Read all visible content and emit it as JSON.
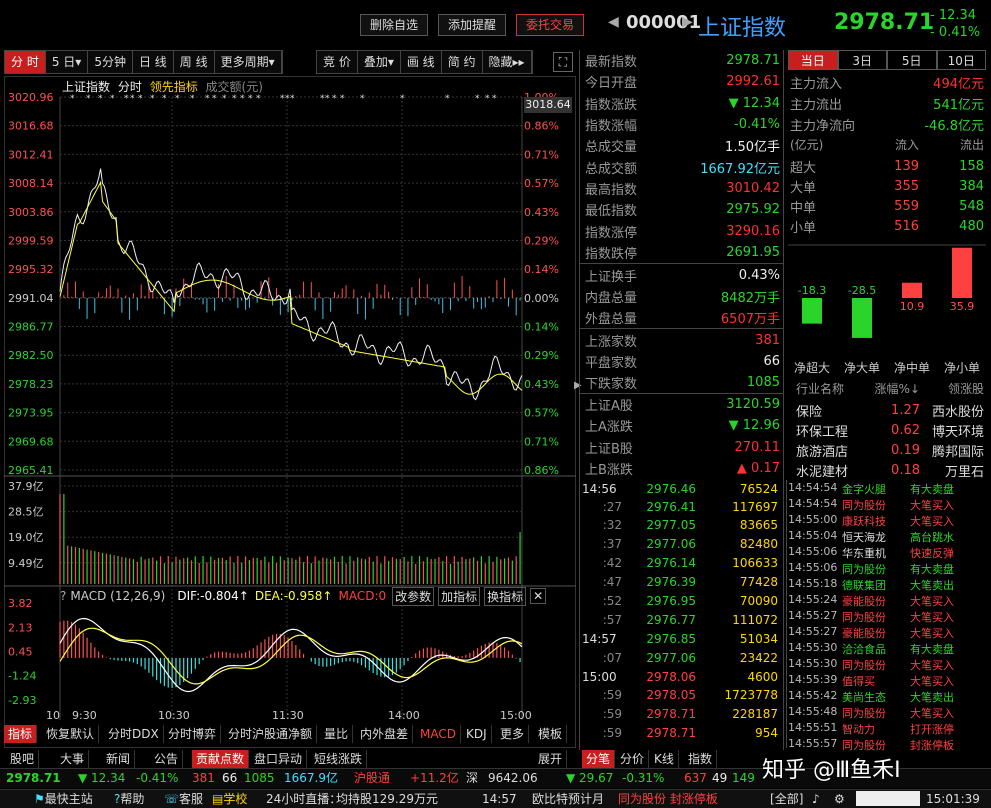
{
  "header": {
    "btn_delete": "删除自选",
    "btn_alert": "添加提醒",
    "btn_order": "委托交易",
    "code": "000001",
    "name": "上证指数",
    "price": "2978.71",
    "change": "- 12.34",
    "pct": "- 0.41%"
  },
  "toolbar": [
    "分 时",
    "5 日▾",
    "5分钟",
    "日 线",
    "周 线",
    "更多周期▾",
    "竞 价",
    "叠加▾",
    "画 线",
    "简 约",
    "隐藏▸▸"
  ],
  "chart_header": {
    "a": "上证指数",
    "b": "分时",
    "c": "领先指标",
    "d": "成交额(元)"
  },
  "price_axis_left": [
    "3020.96",
    "3016.68",
    "3012.41",
    "3008.14",
    "3003.86",
    "2999.59",
    "2995.32",
    "2991.04",
    "2986.77",
    "2982.50",
    "2978.23",
    "2973.95",
    "2969.68",
    "2965.41"
  ],
  "price_axis_right": [
    "1.00%",
    "0.86%",
    "0.71%",
    "0.57%",
    "0.43%",
    "0.29%",
    "0.14%",
    "0.00%",
    "0.14%",
    "0.29%",
    "0.43%",
    "0.57%",
    "0.71%",
    "0.86%"
  ],
  "hover_label": "3018.64",
  "vol_axis": [
    "37.9亿",
    "28.5亿",
    "19.0亿",
    "9.49亿"
  ],
  "macd": {
    "title": "MACD (12,26,9)",
    "dif": "DIF:-0.804↑",
    "dea": "DEA:-0.958↑",
    "macd": "MACD:0",
    "b1": "改参数",
    "b2": "加指标",
    "b3": "换指标",
    "axis": [
      "3.82",
      "2.13",
      "0.45",
      "-1.24",
      "-2.93"
    ]
  },
  "time_axis": [
    "10",
    "9:30",
    "10:30",
    "11:30",
    "14:00",
    "15:00"
  ],
  "quotes": [
    {
      "l": "最新指数",
      "v": "2978.71",
      "c": "green"
    },
    {
      "l": "今日开盘",
      "v": "2992.61",
      "c": "red"
    },
    {
      "l": "指数涨跌",
      "v": "▼ 12.34",
      "c": "green"
    },
    {
      "l": "指数涨幅",
      "v": "-0.41%",
      "c": "green"
    },
    {
      "l": "总成交量",
      "v": "1.50亿手",
      "c": "white"
    },
    {
      "l": "总成交额",
      "v": "1667.92亿元",
      "c": "cyan"
    },
    {
      "l": "最高指数",
      "v": "3010.42",
      "c": "red"
    },
    {
      "l": "最低指数",
      "v": "2975.92",
      "c": "green"
    },
    {
      "l": "指数涨停",
      "v": "3290.16",
      "c": "red"
    },
    {
      "l": "指数跌停",
      "v": "2691.95",
      "c": "green"
    },
    {
      "l": "上证换手",
      "v": "0.43%",
      "c": "white"
    },
    {
      "l": "内盘总量",
      "v": "8482万手",
      "c": "green"
    },
    {
      "l": "外盘总量",
      "v": "6507万手",
      "c": "red"
    },
    {
      "l": "上涨家数",
      "v": "381",
      "c": "red"
    },
    {
      "l": "平盘家数",
      "v": "66",
      "c": "white"
    },
    {
      "l": "下跌家数",
      "v": "1085",
      "c": "green"
    },
    {
      "l": "上证A股",
      "v": "3120.59",
      "c": "green"
    },
    {
      "l": "上A涨跌",
      "v": "▼ 12.96",
      "c": "green"
    },
    {
      "l": "上证B股",
      "v": "270.11",
      "c": "red"
    },
    {
      "l": "上B涨跌",
      "v": "▲ 0.17",
      "c": "red"
    }
  ],
  "flow_tabs": [
    "当日",
    "3日",
    "5日",
    "10日"
  ],
  "flow": [
    {
      "l": "主力流入",
      "v": "494亿元",
      "c": "red"
    },
    {
      "l": "主力流出",
      "v": "541亿元",
      "c": "green"
    },
    {
      "l": "主力净流向",
      "v": "-46.8亿元",
      "c": "green"
    }
  ],
  "flow_table": {
    "h": [
      "(亿元)",
      "流入",
      "流出"
    ],
    "rows": [
      [
        "超大",
        "139",
        "158"
      ],
      [
        "大单",
        "355",
        "384"
      ],
      [
        "中单",
        "559",
        "548"
      ],
      [
        "小单",
        "516",
        "480"
      ]
    ]
  },
  "net_flow": {
    "values": [
      -18.3,
      -28.5,
      10.9,
      35.9
    ],
    "labels": [
      "-18.3",
      "-28.5",
      "10.9",
      "35.9"
    ],
    "cats": [
      "净超大",
      "净大单",
      "净中单",
      "净小单"
    ]
  },
  "industry": {
    "h": [
      "行业名称",
      "涨幅%↓",
      "领涨股"
    ],
    "rows": [
      [
        "保险",
        "1.27",
        "西水股份"
      ],
      [
        "环保工程",
        "0.62",
        "博天环境"
      ],
      [
        "旅游酒店",
        "0.19",
        "腾邦国际"
      ],
      [
        "水泥建材",
        "0.18",
        "万里石"
      ]
    ]
  },
  "ticks": [
    [
      "14:56",
      "2976.46",
      "76524"
    ],
    [
      ":27",
      "2976.41",
      "117697"
    ],
    [
      ":32",
      "2977.05",
      "83665"
    ],
    [
      ":37",
      "2977.06",
      "82480"
    ],
    [
      ":42",
      "2976.14",
      "106633"
    ],
    [
      ":47",
      "2976.39",
      "77428"
    ],
    [
      ":52",
      "2976.95",
      "70090"
    ],
    [
      ":57",
      "2976.77",
      "111072"
    ],
    [
      "14:57",
      "2976.85",
      "51034"
    ],
    [
      ":07",
      "2977.06",
      "23422"
    ],
    [
      "15:00",
      "2978.06",
      "4600"
    ],
    [
      ":59",
      "2978.05",
      "1723778"
    ],
    [
      ":59",
      "2978.71",
      "228187"
    ],
    [
      ":59",
      "2978.71",
      "954"
    ]
  ],
  "signals": [
    [
      "14:54:54",
      "金字火腿",
      "有大卖盘"
    ],
    [
      "14:54:54",
      "同为股份",
      "大笔买入"
    ],
    [
      "14:55:00",
      "康跃科技",
      "大笔买入"
    ],
    [
      "14:55:04",
      "恒天海龙",
      "高台跳水"
    ],
    [
      "14:55:06",
      "华东重机",
      "快速反弹"
    ],
    [
      "14:55:06",
      "同为股份",
      "有大卖盘"
    ],
    [
      "14:55:18",
      "德联集团",
      "大笔卖出"
    ],
    [
      "14:55:24",
      "豪能股份",
      "大笔买入"
    ],
    [
      "14:55:27",
      "同为股份",
      "大笔买入"
    ],
    [
      "14:55:27",
      "豪能股份",
      "大笔买入"
    ],
    [
      "14:55:30",
      "洽洽食品",
      "有大卖盘"
    ],
    [
      "14:55:30",
      "同为股份",
      "大笔买入"
    ],
    [
      "14:55:39",
      "值得买",
      "大笔买入"
    ],
    [
      "14:55:42",
      "美尚生态",
      "大笔卖出"
    ],
    [
      "14:55:48",
      "同为股份",
      "大笔买入"
    ],
    [
      "14:55:51",
      "智动力",
      "打开涨停"
    ],
    [
      "14:55:57",
      "同为股份",
      "封涨停板"
    ]
  ],
  "bottom_tabs": [
    "指标",
    "恢复默认",
    "分时DDX",
    "分时博弈",
    "分时沪股通净额",
    "量比",
    "内外盘差",
    "MACD",
    "KDJ",
    "更多",
    "模板"
  ],
  "news_tabs": [
    "股吧",
    "大事",
    "新闻",
    "公告",
    "贡献点数",
    "盘口异动",
    "短线涨跌",
    "展开"
  ],
  "right_tabs": [
    "分笔",
    "分价",
    "K线",
    "指数"
  ],
  "status1": {
    "p": "2978.71",
    "c": "▼ 12.34",
    "pct": "-0.41%",
    "up": "381",
    "flat": "66",
    "down": "1085",
    "amt": "1667.9亿",
    "hk": "沪股通",
    "hkv": "+11.2亿",
    "sz": "深",
    "szp": "9642.06",
    "szc": "▼ 29.67",
    "szpct": "-0.31%",
    "szup": "637",
    "szf": "49",
    "szd": "149"
  },
  "status2": {
    "a": "最快主站",
    "b": "帮助",
    "c": "客服",
    "d": "学校",
    "e": "24小时直播：",
    "f": "均持股129.29万元",
    "g": "14:57",
    "h": "欧比特预计月",
    "i": "同为股份 封涨停板",
    "j": "全部",
    "k": "15:01:39"
  },
  "watermark": "知乎 @Ⅲ鱼禾I"
}
